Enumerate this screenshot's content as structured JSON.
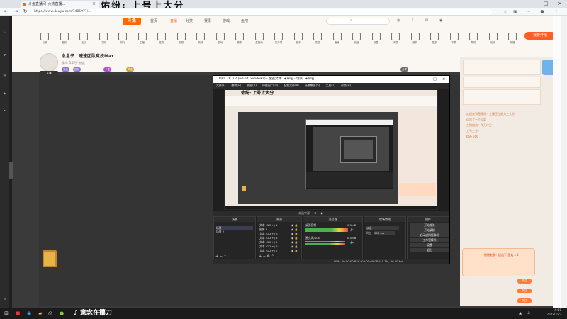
{
  "browser": {
    "tab_title": "斗鱼直播间_火热直播...",
    "url": "https://www.douyu.com/7405977/...",
    "watermark": "佑纷: 上号上大分"
  },
  "site": {
    "logo": "斗鱼",
    "nav": [
      "首页",
      "分类",
      "直播",
      "赛事",
      "游戏",
      "鱼吧"
    ],
    "active_nav": "直播",
    "live_button": "我要开播",
    "icon_row": [
      "日推",
      "签到",
      "活动",
      "订阅",
      "排行",
      "主播",
      "任务",
      "视频",
      "商城",
      "游戏",
      "赛事",
      "直播间",
      "客户端",
      "圈子",
      "发现",
      "鱼塘",
      "充值",
      "设置",
      "消息",
      "我的",
      "更多",
      "下载",
      "帮助",
      "历史",
      "开播"
    ]
  },
  "room": {
    "streamer_title": "念念子：速速团队竞技Max",
    "sub_info": "观众: 3.2万 · 热度",
    "avatar_tag": "主播",
    "tags": [
      "竞技",
      "团队",
      "个性",
      "关注",
      "分享"
    ]
  },
  "right_panel": {
    "chat": [
      "欢迎来到直播间！主播正在努力上大分",
      "送出了一个火箭",
      "主播加油！今天冲分",
      "上号上号！",
      "666 666"
    ],
    "gift_popup": "谢谢老板！送出了 鱼丸 x 1",
    "pill": "关注"
  },
  "obs": {
    "title": "OBS 28.0.2 (64-bit, windows) - 配置文件: 未命名 - 场景: 未命名",
    "menu": [
      "文件(F)",
      "编辑(E)",
      "视图(V)",
      "停靠窗口(D)",
      "配置文件(P)",
      "场景集合(S)",
      "工具(T)",
      "帮助(H)"
    ],
    "inner_watermark": "佑纷: 上号上大分",
    "status_text": "未选中源",
    "docks": {
      "scenes": {
        "title": "场景",
        "items": [
          "场景",
          "场景 2"
        ]
      },
      "sources": {
        "title": "来源",
        "items": [
          "文本 (GDI+) 1",
          "图像 2",
          "文本 (GDI+) 3",
          "文本 (GDI+) 4",
          "文本 (GDI+) 5",
          "文本 (GDI+) 6",
          "文本 (GDI+) 7"
        ]
      },
      "mixer": {
        "title": "混音器",
        "channels": [
          "桌面音频",
          "麦克风/Aux"
        ],
        "db": [
          "0.0 dB",
          "0.0 dB"
        ]
      },
      "transitions": {
        "title": "转场特效",
        "fade": "淡出",
        "duration_label": "时长",
        "duration": "300 ms"
      },
      "controls": {
        "title": "控件",
        "buttons": [
          "开始推流",
          "开始录制",
          "启动虚拟摄像机",
          "工作室模式",
          "设置",
          "退出"
        ]
      }
    },
    "bottom": "LIVE: 00:00:00   REC: 00:00:00   CPU: 1.3%, 60.00 fps"
  },
  "taskbar": {
    "tiktok_text": "意念在攥刀",
    "time": "19:30",
    "date": "2022/10/7"
  },
  "colors": {
    "accent": "#ff5d23",
    "obs_bg": "#1f1f1f"
  }
}
